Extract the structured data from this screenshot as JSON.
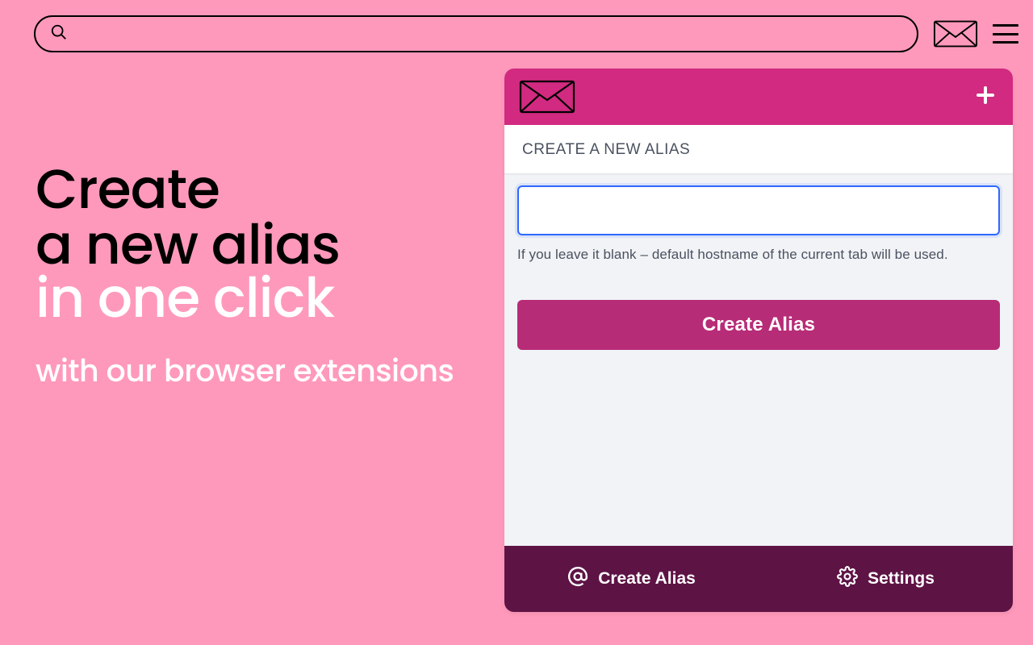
{
  "topbar": {
    "search_value": "",
    "search_placeholder": ""
  },
  "hero": {
    "line1a": "Create",
    "line1b": "a new alias",
    "line2": "in one click",
    "sub": "with our browser extensions"
  },
  "popup": {
    "title": "CREATE A NEW ALIAS",
    "alias_value": "",
    "hint": "If you leave it blank – default hostname of the current tab will be used.",
    "create_button": "Create Alias",
    "footer": {
      "create_label": "Create Alias",
      "settings_label": "Settings"
    }
  }
}
